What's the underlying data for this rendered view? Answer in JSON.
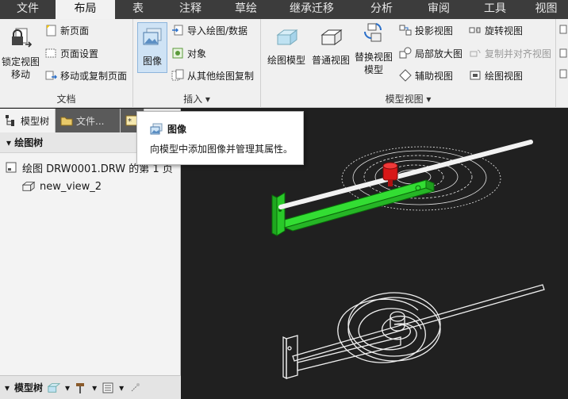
{
  "menubar": {
    "tabs": [
      {
        "label": "文件",
        "active": false
      },
      {
        "label": "布局",
        "active": true
      },
      {
        "label": "表",
        "active": false
      },
      {
        "label": "注释",
        "active": false
      },
      {
        "label": "草绘",
        "active": false
      },
      {
        "label": "继承迁移",
        "active": false
      },
      {
        "label": "分析",
        "active": false
      },
      {
        "label": "审阅",
        "active": false
      },
      {
        "label": "工具",
        "active": false
      },
      {
        "label": "视图",
        "active": false
      }
    ]
  },
  "ribbon": {
    "doc_group": {
      "label": "文档",
      "lock_view_line1": "锁定视图",
      "lock_view_line2": "移动",
      "new_page": "新页面",
      "page_setup": "页面设置",
      "move_copy_page": "移动或复制页面"
    },
    "insert_group": {
      "label": "插入",
      "image": "图像",
      "import_drawing": "导入绘图/数据",
      "object": "对象",
      "from_other_drawing": "从其他绘图复制"
    },
    "model_view_group": {
      "label": "模型视图",
      "drawing_model": "绘图模型",
      "general_view": "普通视图",
      "replace_view_line1": "替换视图",
      "replace_view_line2": "模型",
      "projection_view": "投影视图",
      "detailed_view": "局部放大图",
      "auxiliary_view": "辅助视图",
      "revolved_view": "旋转视图",
      "copy_align_view": "复制并对齐视图",
      "drawing_view": "绘图视图"
    }
  },
  "panel": {
    "tabs": [
      {
        "label": "模型树"
      },
      {
        "label": "文件..."
      }
    ],
    "tree_header": "绘图树",
    "tree_items": [
      {
        "label": "绘图 DRW0001.DRW 的第 1 页"
      },
      {
        "label": "new_view_2"
      }
    ],
    "bottom_label": "模型树"
  },
  "tooltip": {
    "title": "图像",
    "description": "向模型中添加图像并管理其属性。"
  },
  "colors": {
    "menubar_bg": "#3c3c3c",
    "ribbon_bg": "#f0f0f0",
    "canvas_bg": "#202020",
    "model_green": "#2fd62f",
    "model_red": "#d81818",
    "selection_blue": "#cfe3f5"
  },
  "icons": [
    "lock-icon",
    "new-page-icon",
    "page-setup-icon",
    "move-copy-page-icon",
    "image-icon",
    "import-icon",
    "object-icon",
    "copy-from-drawing-icon",
    "drawing-model-icon",
    "general-view-icon",
    "replace-view-icon",
    "projection-view-icon",
    "detailed-view-icon",
    "auxiliary-view-icon",
    "revolved-view-icon",
    "copy-align-view-icon",
    "drawing-view-icon",
    "tree-icon",
    "folder-icon",
    "sheet-icon",
    "view-icon",
    "settings-icon",
    "hammer-icon",
    "list-icon",
    "pin-icon"
  ]
}
